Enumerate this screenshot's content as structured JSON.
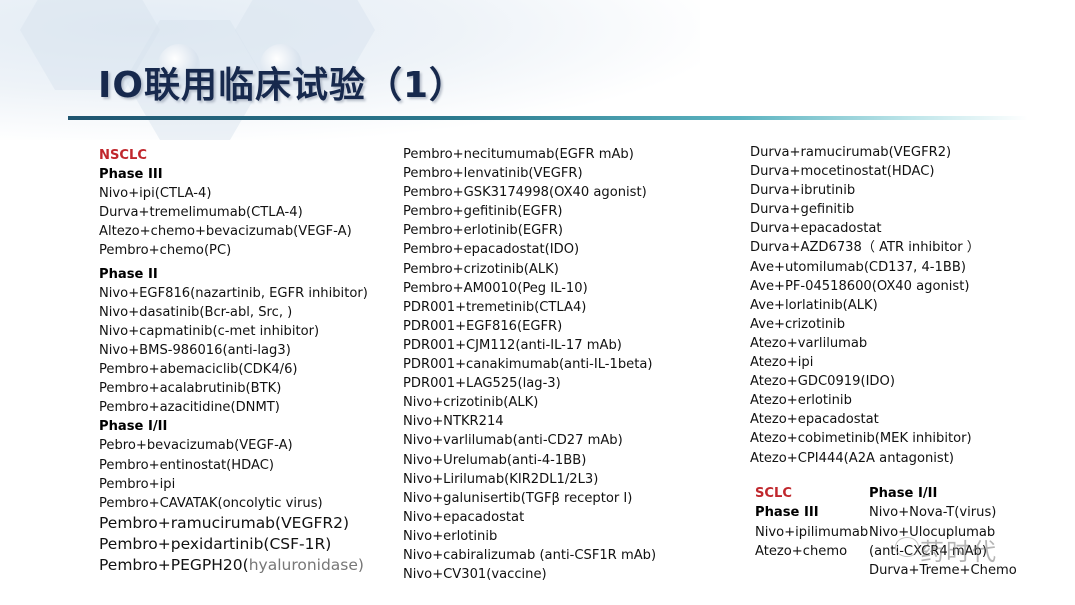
{
  "title": "IO联用临床试验（1）",
  "nsclc": {
    "label": "NSCLC",
    "phase3": {
      "label": "Phase III",
      "items": [
        "Nivo+ipi(CTLA-4)",
        "Durva+tremelimumab(CTLA-4)",
        "Altezo+chemo+bevacizumab(VEGF-A)",
        "Pembro+chemo(PC)"
      ]
    },
    "phase2": {
      "label": "Phase II",
      "items": [
        "Nivo+EGF816(nazartinib, EGFR inhibitor)",
        "Nivo+dasatinib(Bcr-abl, Src, )",
        "Nivo+capmatinib(c-met inhibitor)",
        "Nivo+BMS-986016(anti-lag3)",
        "Pembro+abemaciclib(CDK4/6)",
        "Pembro+acalabrutinib(BTK)",
        "Pembro+azacitidine(DNMT)"
      ]
    },
    "phase12": {
      "label": "Phase I/II",
      "items": [
        "Pebro+bevacizumab(VEGF-A)",
        "Pembro+entinostat(HDAC)",
        "Pembro+ipi",
        "Pembro+CAVATAK(oncolytic virus)"
      ],
      "items_large": [
        "Pembro+ramucirumab(VEGFR2)",
        "Pembro+pexidartinib(CSF-1R)"
      ],
      "last_item_prefix": "Pembro+PEGPH20(",
      "last_item_muted": "hyaluronidase)"
    },
    "column2": [
      "Pembro+necitumumab(EGFR mAb)",
      "Pembro+lenvatinib(VEGFR)",
      "Pembro+GSK3174998(OX40 agonist)",
      "Pembro+gefitinib(EGFR)",
      "Pembro+erlotinib(EGFR)",
      "Pembro+epacadostat(IDO)",
      "Pembro+crizotinib(ALK)",
      "Pembro+AM0010(Peg IL-10)",
      "PDR001+tremetinib(CTLA4)",
      "PDR001+EGF816(EGFR)",
      "PDR001+CJM112(anti-IL-17 mAb)",
      "PDR001+canakimumab(anti-IL-1beta)",
      "PDR001+LAG525(lag-3)",
      "Nivo+crizotinib(ALK)",
      "Nivo+NTKR214",
      "Nivo+varlilumab(anti-CD27 mAb)",
      "Nivo+Urelumab(anti-4-1BB)",
      "Nivo+Lirilumab(KIR2DL1/2L3)",
      "Nivo+galunisertib(TGFβ receptor I)",
      "Nivo+epacadostat",
      "Nivo+erlotinib",
      "Nivo+cabiralizumab (anti-CSF1R mAb)",
      "Nivo+CV301(vaccine)"
    ],
    "column3": [
      "Durva+ramucirumab(VEGFR2)",
      "Durva+mocetinostat(HDAC)",
      "Durva+ibrutinib",
      "Durva+gefinitib",
      "Durva+epacadostat",
      "Durva+AZD6738（ ATR inhibitor ）",
      "Ave+utomilumab(CD137, 4-1BB)",
      "Ave+PF-04518600(OX40 agonist)",
      "Ave+lorlatinib(ALK)",
      "Ave+crizotinib",
      "Atezo+varlilumab",
      "Atezo+ipi",
      "Atezo+GDC0919(IDO)",
      "Atezo+erlotinib",
      "Atezo+epacadostat",
      "Atezo+cobimetinib(MEK inhibitor)",
      "Atezo+CPI444(A2A antagonist)"
    ]
  },
  "sclc": {
    "label": "SCLC",
    "phase3": {
      "label": "Phase III",
      "items": [
        "Nivo+ipilimumab",
        "Atezo+chemo"
      ]
    },
    "phase12": {
      "label": "Phase I/II",
      "items": [
        "Nivo+Nova-T(virus)",
        "Nivo+Ulocuplumab",
        "(anti-CXCR4 mAb)",
        "Durva+Treme+Chemo"
      ]
    }
  },
  "watermark": "药时代"
}
